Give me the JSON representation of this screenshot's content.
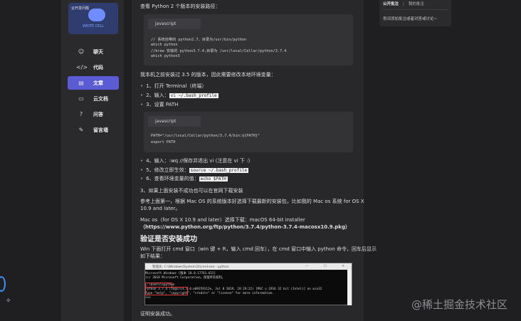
{
  "logo": {
    "top_text": "云开发问题",
    "bottom_text": "WRITE CELL"
  },
  "nav": [
    {
      "label": "聊天",
      "icon": "☺",
      "active": false
    },
    {
      "label": "代码",
      "icon": "</>",
      "active": false
    },
    {
      "label": "文章",
      "icon": "▤",
      "active": true
    },
    {
      "label": "云文档",
      "icon": "▭",
      "active": false
    },
    {
      "label": "问答",
      "icon": "?",
      "active": false
    },
    {
      "label": "留言墙",
      "icon": "✎",
      "active": false
    }
  ],
  "article": {
    "p_find_path": "查看 Python 2 个版本的安装路径：",
    "code1": {
      "lang": "javascript",
      "lines": [
        "// 系统自带的 python2.7，目录为/usr/bin/python",
        "which python",
        "//brew 安装的 python3.7.4,目录为 /usr/local/Cellar/python/3.7.4",
        "which python3"
      ]
    },
    "p_env": "我本机之前安装过 3.5 的版本，因此需要修改本地环境变量：",
    "steps_a": [
      {
        "text": "1、打开 Terminal（终端）",
        "code": ""
      },
      {
        "text": "2、输入：",
        "code": "vi ~/.bash_profile"
      },
      {
        "text": "3、设置 PATH",
        "code": ""
      }
    ],
    "code2": {
      "lang": "javascript",
      "lines": [
        "PATH=\"/usr/local/Cellar/python/3.7.4/bin:${PATH}\"",
        "export PATH"
      ]
    },
    "steps_b": [
      {
        "text": "4、输入：:wq  //保存并退出 vi (注意在 vi 下 :)",
        "code": ""
      },
      {
        "text": "5、修改立即生效：",
        "code": "source ~/.bash_profile"
      },
      {
        "text": "6、查看环境变量的值：",
        "code": "echo $PATH"
      }
    ],
    "p_fail": "3、如果上面安装不成功也可以在官网下载安装",
    "p_ref1": "参考上面第一，根据 Mac OS 的系统版本好选择下载最新的安装包，比如我的 Mac os 系统 for OS X",
    "p_ref2": "10.9 and later。",
    "p_mac1": "Mac os（for OS X 10.9 and later）选择下载：macOS 64-bit installer",
    "p_mac2": "（https://www.python.org/ftp/python/3.7.4/python-3.7.4-macosx10.9.pkg）",
    "h_verify": "验证是否安装成功",
    "p_win1": "Win 下面打开 cmd 窗口（win 键 + R，输入 cmd 回车），在 cmd 窗口中输入 python 命令，回车后显示",
    "p_win2": "如下结果：",
    "cmd": {
      "title": "管理员: C:\\Windows\\System32\\cmd.exe - python",
      "controls": "— ☐ ✕",
      "lines": [
        "Microsoft Windows [版本 10.0.17763.615]",
        "(c) 2018 Microsoft Corporation。保留所有权利。",
        "",
        "C:\\Users\\>python",
        "Python 3.7.4 (tags/v3.7.4:e09359112e, Jul  8 2019, 19:29:22) [MSC v.1916 32 bit (Intel)] on win32",
        "Type \"help\", \"copyright\", \"credits\" or \"license\" for more information.",
        ">>>"
      ]
    },
    "p_ok": "证明安装成功。"
  },
  "right_panel": {
    "tab_public": "公开批注",
    "separator": "|",
    "tab_mine": "我的批注",
    "empty_hint": "划词添加批注或者对答或讨论~"
  },
  "watermark": "@稀土掘金技术社区"
}
